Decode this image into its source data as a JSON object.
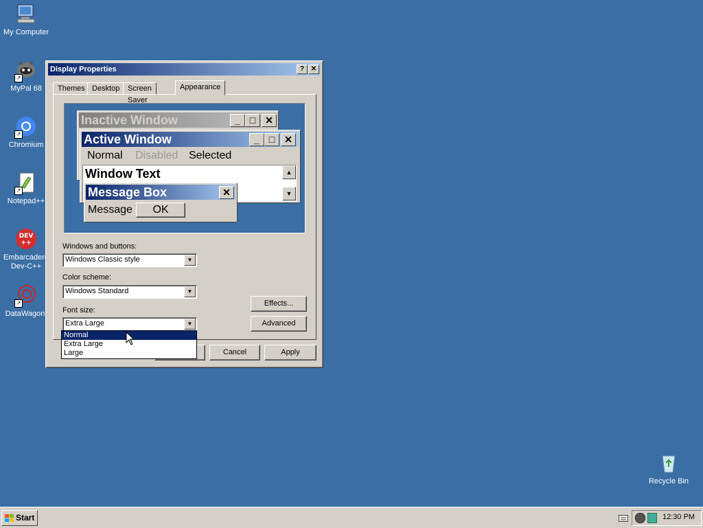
{
  "desktop": {
    "icons": [
      {
        "label": "My Computer",
        "icon": "computer-icon"
      },
      {
        "label": "MyPal 68",
        "icon": "mypal-icon"
      },
      {
        "label": "Chromium",
        "icon": "chromium-icon"
      },
      {
        "label": "Notepad++",
        "icon": "notepad-icon"
      },
      {
        "label": "Embarcadero Dev-C++",
        "icon": "devcpp-icon"
      },
      {
        "label": "DataWagon.",
        "icon": "datawagon-icon"
      },
      {
        "label": "Recycle Bin",
        "icon": "recycle-bin-icon"
      }
    ]
  },
  "dialog": {
    "title": "Display Properties",
    "help_btn": "?",
    "close_btn": "✕",
    "tabs": [
      "Themes",
      "Desktop",
      "Screen Saver",
      "Appearance"
    ],
    "active_tab": "Appearance",
    "preview": {
      "inactive_title": "Inactive Window",
      "active_title": "Active Window",
      "menu_normal": "Normal",
      "menu_disabled": "Disabled",
      "menu_selected": "Selected",
      "window_text": "Window Text",
      "msgbox_title": "Message Box",
      "msgbox_text": "Message T",
      "ok": "OK"
    },
    "windows_buttons_label": "Windows and buttons:",
    "windows_buttons_value": "Windows Classic style",
    "color_scheme_label": "Color scheme:",
    "color_scheme_value": "Windows Standard",
    "font_size_label": "Font size:",
    "font_size_value": "Extra Large",
    "font_size_options": [
      "Normal",
      "Extra Large",
      "Large"
    ],
    "font_size_highlight": "Normal",
    "effects_btn": "Effects...",
    "advanced_btn": "Advanced",
    "cancel_btn": "Cancel",
    "apply_btn": "Apply"
  },
  "taskbar": {
    "start": "Start",
    "clock": "12:30 PM"
  },
  "colors": {
    "desktop": "#3a6ea5",
    "title_active": "#0a246a",
    "face": "#d4d0c8"
  }
}
